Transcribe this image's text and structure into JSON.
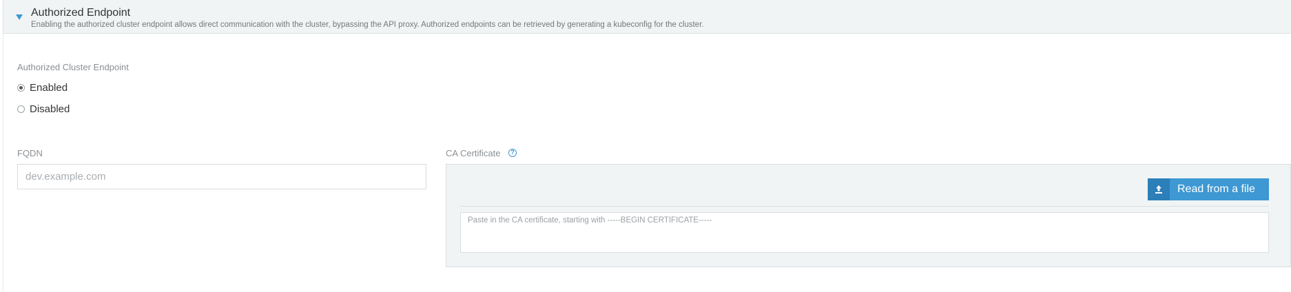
{
  "accordion": {
    "title": "Authorized Endpoint",
    "description": "Enabling the authorized cluster endpoint allows direct communication with the cluster, bypassing the API proxy. Authorized endpoints can be retrieved by generating a kubeconfig for the cluster.",
    "expanded": true,
    "caret_icon": "caret-down-icon"
  },
  "endpoint": {
    "label": "Authorized Cluster Endpoint",
    "options": [
      {
        "label": "Enabled",
        "checked": true
      },
      {
        "label": "Disabled",
        "checked": false
      }
    ]
  },
  "fqdn": {
    "label": "FQDN",
    "value": "",
    "placeholder": "dev.example.com"
  },
  "ca_certificate": {
    "label": "CA Certificate",
    "help_icon": "question-circle-icon",
    "help_glyph": "?",
    "read_button_label": "Read from a file",
    "upload_icon": "upload-icon",
    "value": "",
    "placeholder": "Paste in the CA certificate, starting with -----BEGIN CERTIFICATE-----"
  },
  "colors": {
    "accent": "#3d98d3",
    "header_bg": "#f1f4f5",
    "label_gray": "#8a8f94"
  }
}
